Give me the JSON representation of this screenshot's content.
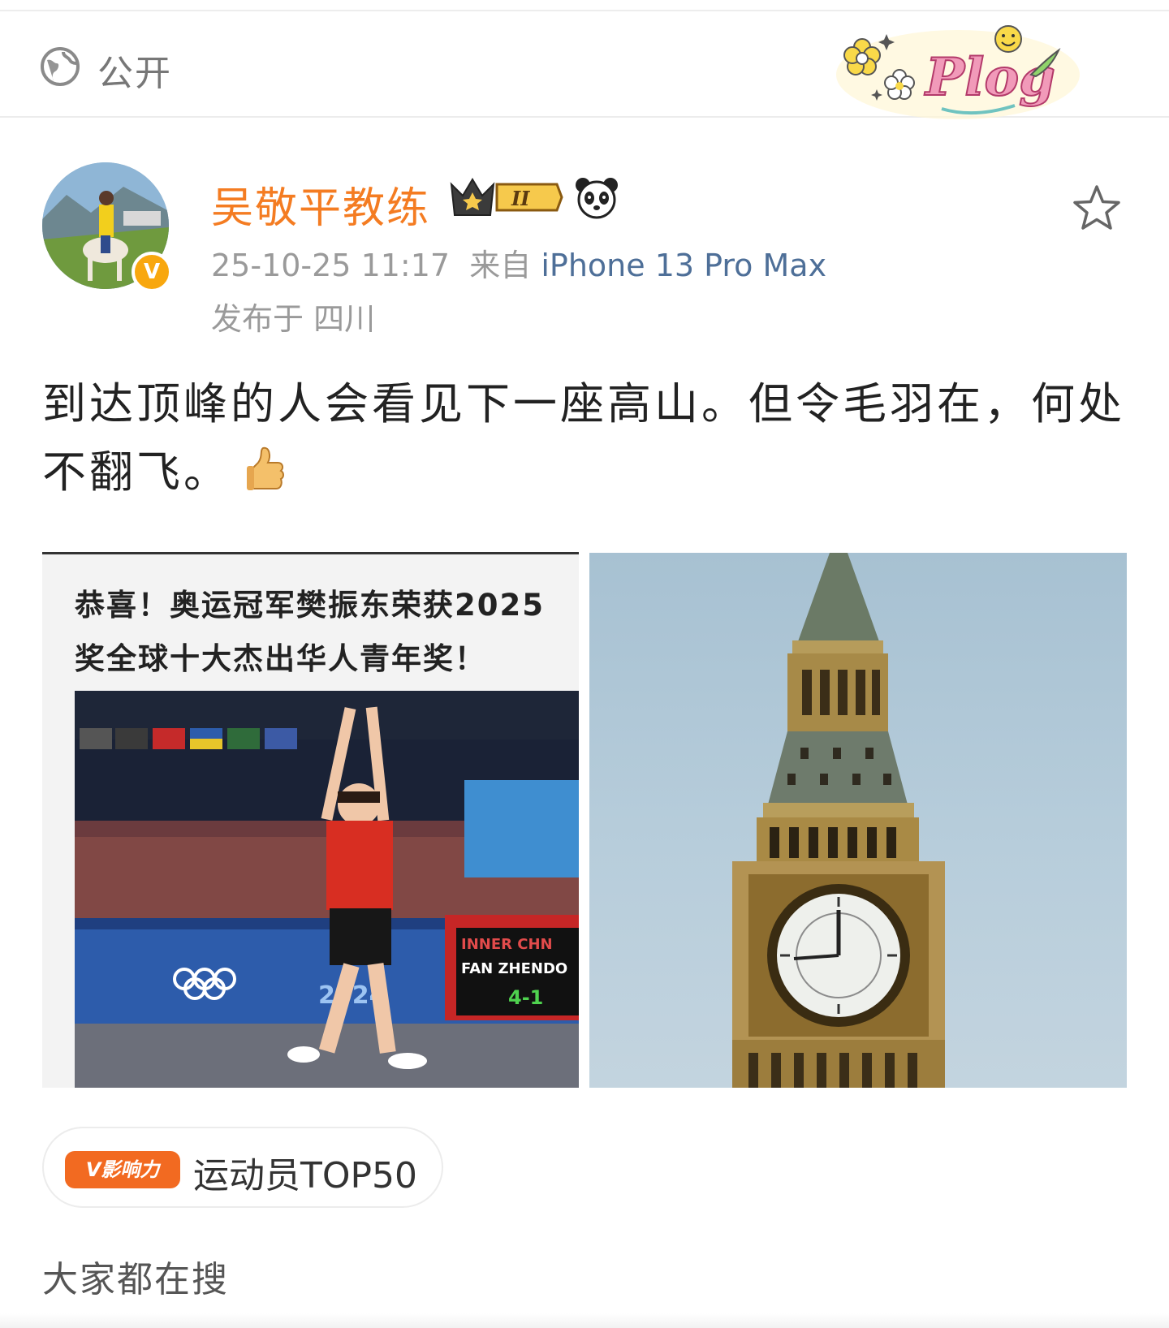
{
  "visibility": {
    "icon": "globe-icon",
    "label": "公开"
  },
  "decoration": {
    "sticker_text": "Plog"
  },
  "author": {
    "name": "吴敬平教练",
    "avatar": "avatar-photo",
    "verified_badge": "V",
    "level_badge": "II",
    "name_color": "#f47c22"
  },
  "post": {
    "time": "25-10-25 11:17",
    "source_prefix": "来自",
    "device": "iPhone 13 Pro Max",
    "location": "发布于 四川",
    "text": "到达顶峰的人会看见下一座高山。但令毛羽在，何处不翻飞。",
    "emoji": "thumbs-up-icon"
  },
  "images": [
    {
      "title_line1": "恭喜！奥运冠军樊振东荣获2025",
      "title_line2": "奖全球十大杰出华人青年奖！",
      "score_line1": "INNER  CHN",
      "score_line2": "FAN ZHENDO",
      "score": "4-1",
      "banner_text": "2024"
    },
    {
      "subject": "clock-tower-photo"
    }
  ],
  "topic": {
    "badge": "V影响力",
    "label": "运动员TOP50"
  },
  "section": {
    "search_title": "大家都在搜"
  },
  "colors": {
    "accent": "#f47c22",
    "link": "#4e6f98",
    "badge": "#f26a21"
  }
}
